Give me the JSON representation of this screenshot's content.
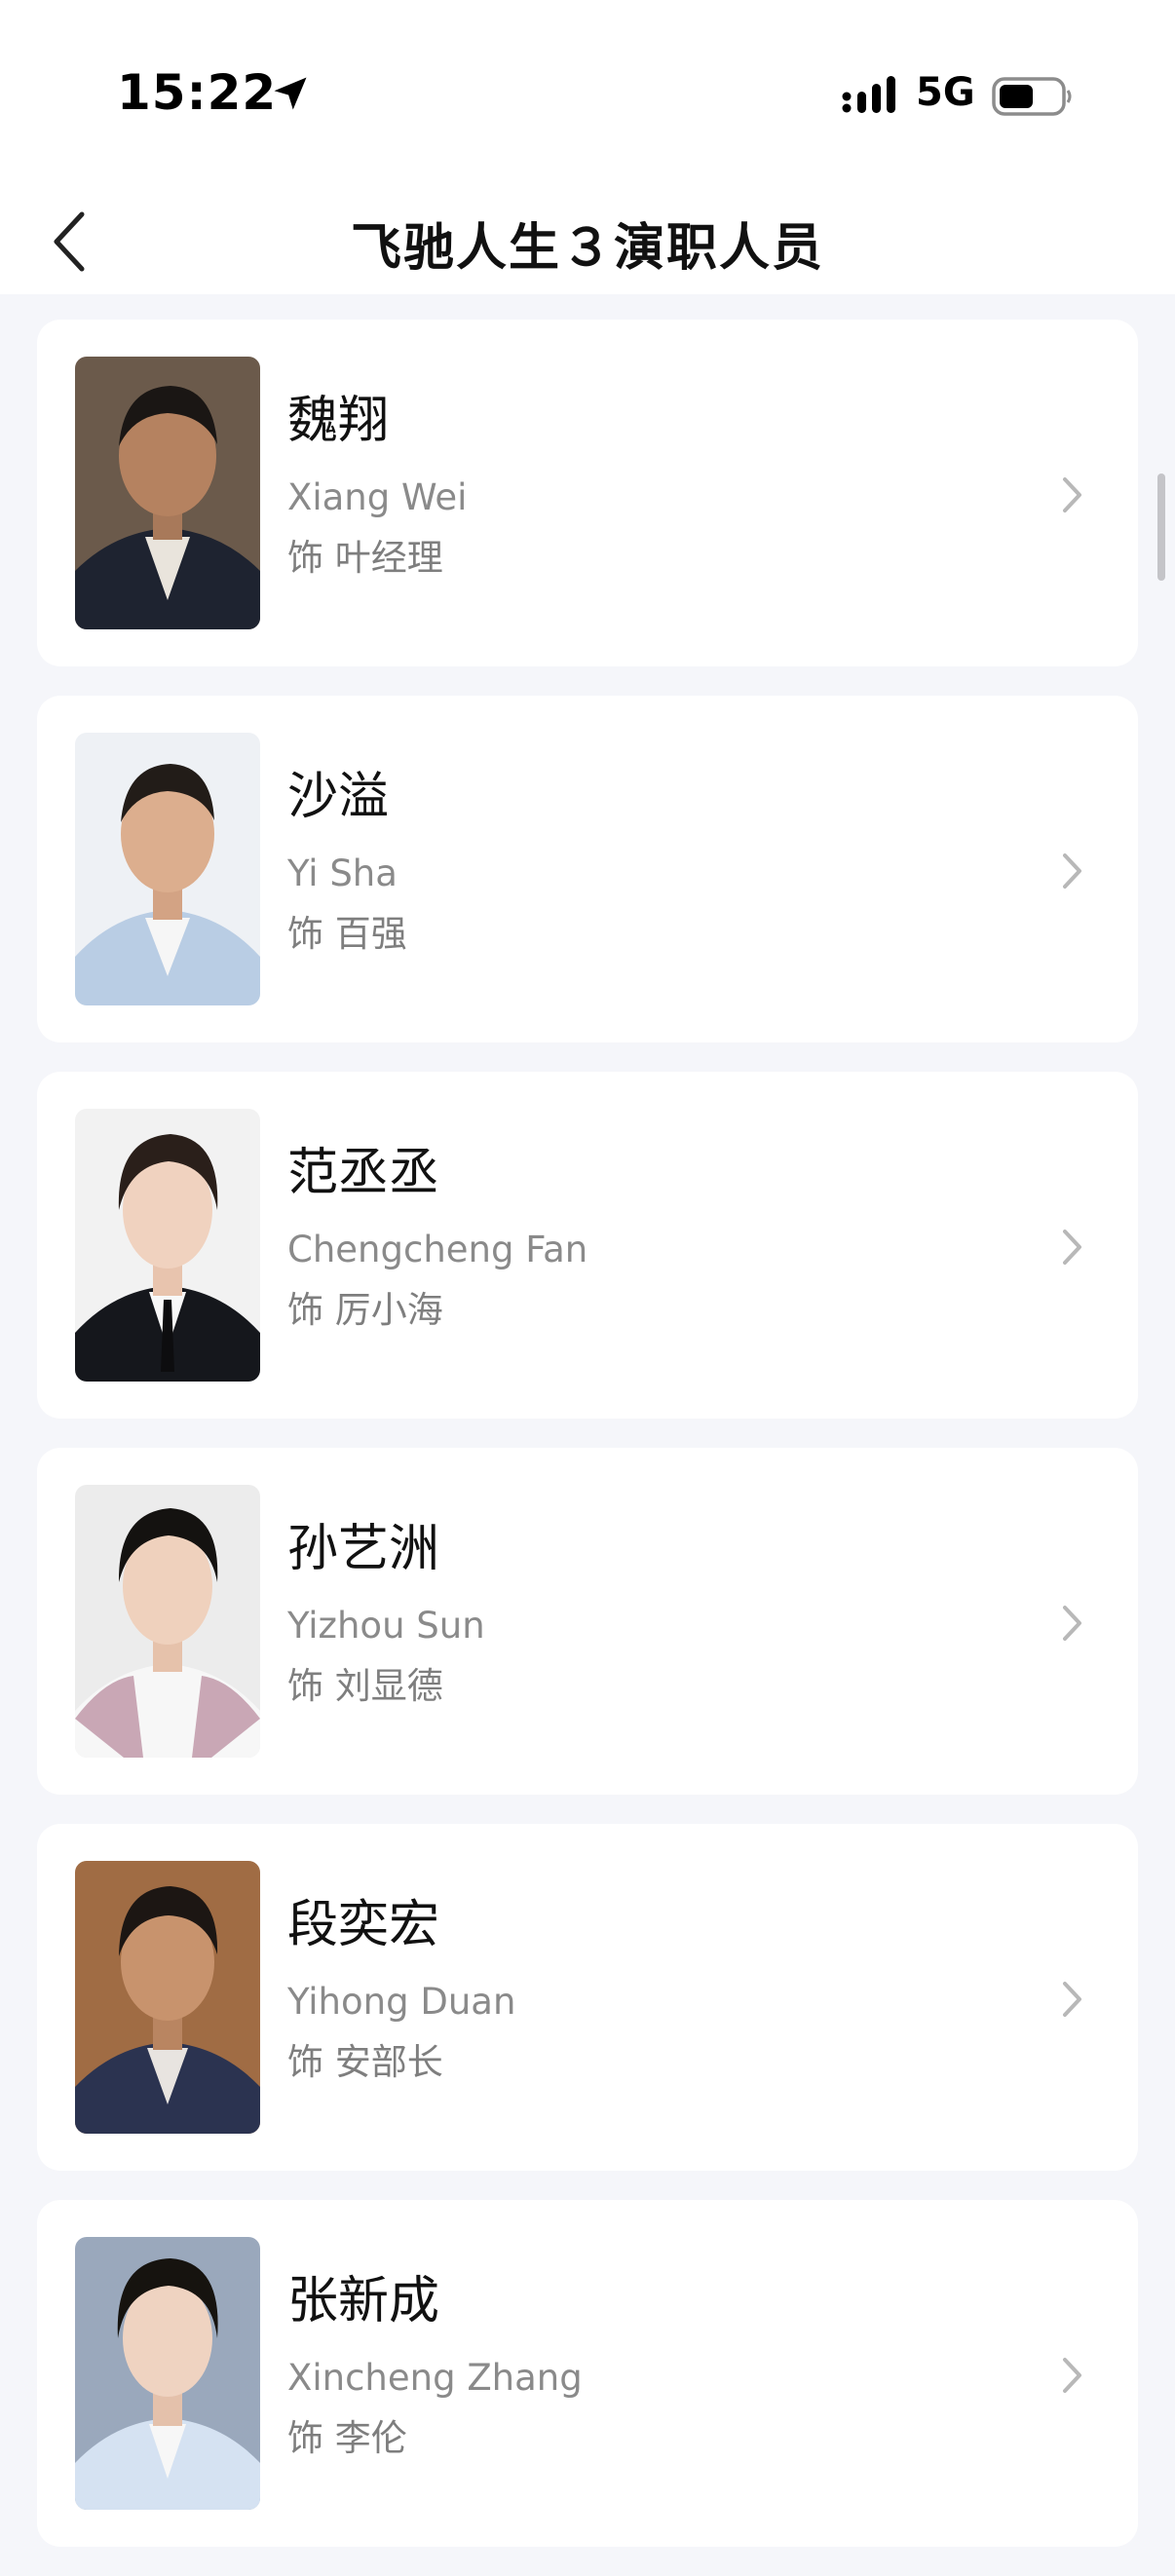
{
  "status_bar": {
    "time": "15:22",
    "network": "5G",
    "icons": [
      "location-arrow-icon",
      "signal-bars-icon",
      "battery-icon"
    ]
  },
  "header": {
    "title": "飞驰人生３演职人员",
    "back_icon": "chevron-left-icon"
  },
  "cast": [
    {
      "name": "魏翔",
      "latin": "Xiang Wei",
      "role": "饰 叶经理"
    },
    {
      "name": "沙溢",
      "latin": "Yi Sha",
      "role": "饰 百强"
    },
    {
      "name": "范丞丞",
      "latin": "Chengcheng Fan",
      "role": "饰 厉小海"
    },
    {
      "name": "孙艺洲",
      "latin": "Yizhou Sun",
      "role": "饰 刘显德"
    },
    {
      "name": "段奕宏",
      "latin": "Yihong Duan",
      "role": "饰 安部长"
    },
    {
      "name": "张新成",
      "latin": "Xincheng Zhang",
      "role": "饰 李伦"
    }
  ],
  "colors": {
    "page_background": "#f5f6fa",
    "card_background": "#ffffff",
    "secondary_text": "#8a8a8a",
    "chevron": "#b8b8b8"
  }
}
